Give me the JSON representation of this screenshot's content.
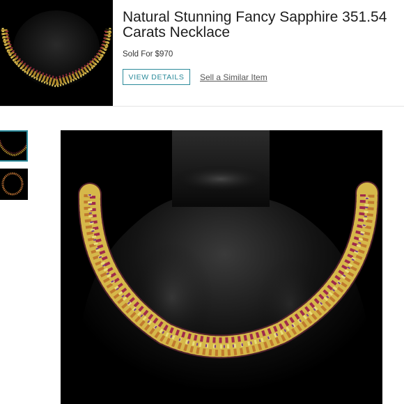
{
  "listing": {
    "title_line1": "Natural Stunning Fancy Sapphire 351.54",
    "title_line2": "Carats Necklace",
    "sold_text": "Sold For $970",
    "view_details_label": "VIEW DETAILS",
    "sell_similar_label": "Sell a Similar Item"
  },
  "gallery": {
    "thumbnails": [
      {
        "name": "Necklace front view"
      },
      {
        "name": "Necklace full loop view"
      }
    ],
    "selected_index": 0
  },
  "colors": {
    "accent": "#2b8a9a",
    "background": "#ffffff",
    "image_bg": "#000000"
  }
}
